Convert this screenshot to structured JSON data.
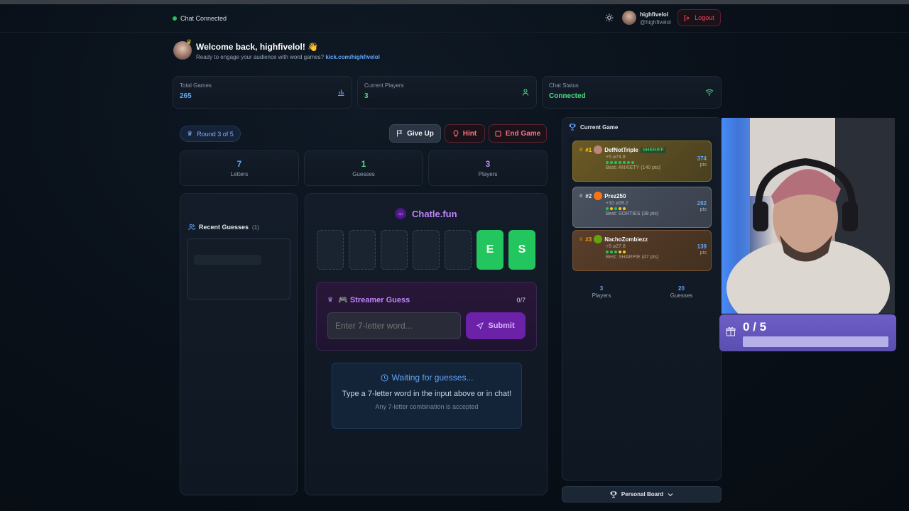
{
  "header": {
    "status": "Chat Connected",
    "username": "highfivelol",
    "handle": "@highfivelol",
    "logout": "Logout"
  },
  "welcome": {
    "title": "Welcome back, highfivelol! 👋",
    "subtitle": "Ready to engage your audience with word games?",
    "link": "kick.com/highfivelol"
  },
  "stats": [
    {
      "label": "Total Games",
      "value": "265",
      "color": "#60a5fa",
      "icon": "bar-chart-icon"
    },
    {
      "label": "Current Players",
      "value": "3",
      "color": "#4ade80",
      "icon": "user-icon"
    },
    {
      "label": "Chat Status",
      "value": "Connected",
      "color": "#4ade80",
      "icon": "wifi-icon"
    }
  ],
  "game": {
    "round": "Round 3 of 5",
    "give_up": "Give Up",
    "hint": "Hint",
    "end_game": "End Game",
    "counters": [
      {
        "value": "7",
        "label": "Letters",
        "color": "#60a5fa"
      },
      {
        "value": "1",
        "label": "Guesses",
        "color": "#4ade80"
      },
      {
        "value": "3",
        "label": "Players",
        "color": "#c084fc"
      }
    ],
    "recent_title": "Recent Guesses",
    "recent_count": "(1)",
    "brand": "Chatle.fun",
    "tiles": [
      "",
      "",
      "",
      "",
      "",
      "E",
      "S"
    ],
    "streamer_title": "🎮 Streamer Guess",
    "streamer_count": "0/7",
    "input_placeholder": "Enter 7-letter word...",
    "submit": "Submit",
    "waiting_title": "Waiting for guesses...",
    "waiting_text": "Type a 7-letter word in the input above or in chat!",
    "waiting_sub": "Any 7-letter combination is accepted"
  },
  "current_game": {
    "title": "Current Game",
    "players": [
      {
        "rank": "#1",
        "name": "DefNotTriple",
        "badge": "SHERIFF",
        "stats": "+5 ⌀74.8",
        "best": "Best: ANXIETY (140 pts)",
        "pts": "374",
        "pts_label": "pts"
      },
      {
        "rank": "#2",
        "name": "Prez250",
        "badge": "",
        "stats": "+10 ⌀28.2",
        "best": "Best: SORTIES (38 pts)",
        "pts": "282",
        "pts_label": "pts"
      },
      {
        "rank": "#3",
        "name": "NachoZombiezz",
        "badge": "",
        "stats": "+5 ⌀27.8",
        "best": "Best: SHARPIE (47 pts)",
        "pts": "139",
        "pts_label": "pts"
      }
    ],
    "summary": [
      {
        "value": "3",
        "label": "Players"
      },
      {
        "value": "20",
        "label": "Guesses"
      }
    ],
    "personal_board": "Personal Board"
  },
  "overlay": {
    "goal": "0 / 5",
    "progress_fraction": 0
  },
  "colors": {
    "accent_purple": "#c084fc",
    "accent_blue": "#60a5fa",
    "accent_green": "#22c55e",
    "danger": "#f43f5e"
  }
}
